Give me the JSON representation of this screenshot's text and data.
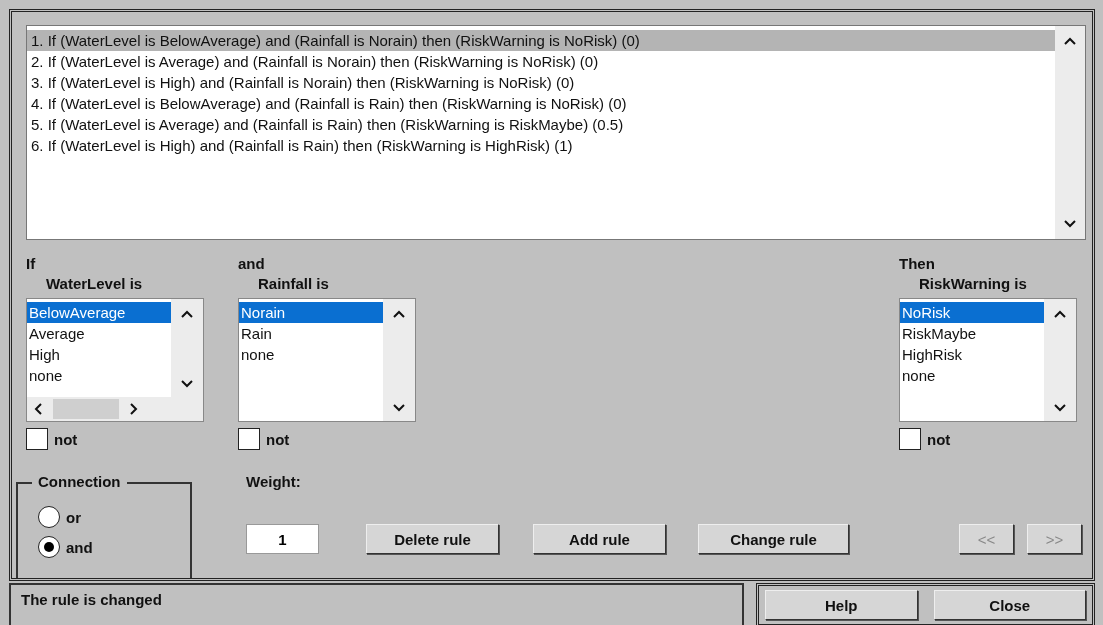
{
  "rules": [
    {
      "text": "1. If (WaterLevel is BelowAverage) and (Rainfall is Norain) then (RiskWarning is NoRisk) (0)",
      "selected": true
    },
    {
      "text": "2. If (WaterLevel is Average) and (Rainfall is Norain) then (RiskWarning is NoRisk) (0)",
      "selected": false
    },
    {
      "text": "3. If (WaterLevel is High) and (Rainfall is Norain) then (RiskWarning is NoRisk) (0)",
      "selected": false
    },
    {
      "text": "4. If (WaterLevel is BelowAverage) and (Rainfall is Rain) then (RiskWarning is NoRisk) (0)",
      "selected": false
    },
    {
      "text": "5. If (WaterLevel is Average) and (Rainfall is Rain) then (RiskWarning is RiskMaybe) (0.5)",
      "selected": false
    },
    {
      "text": "6. If (WaterLevel is High) and (Rainfall is Rain) then (RiskWarning is HighRisk) (1)",
      "selected": false
    }
  ],
  "variables": [
    {
      "prefix": "If",
      "label": "WaterLevel is",
      "horizontal_scrollbar": true,
      "items": [
        {
          "label": "BelowAverage",
          "selected": true
        },
        {
          "label": "Average",
          "selected": false
        },
        {
          "label": "High",
          "selected": false
        },
        {
          "label": "none",
          "selected": false
        }
      ],
      "not_label": "not",
      "not_checked": false
    },
    {
      "prefix": "and",
      "label": "Rainfall is",
      "horizontal_scrollbar": false,
      "items": [
        {
          "label": "Norain",
          "selected": true
        },
        {
          "label": "Rain",
          "selected": false
        },
        {
          "label": "none",
          "selected": false
        }
      ],
      "not_label": "not",
      "not_checked": false
    },
    {
      "prefix": "Then",
      "label": "RiskWarning is",
      "horizontal_scrollbar": false,
      "items": [
        {
          "label": "NoRisk",
          "selected": true
        },
        {
          "label": "RiskMaybe",
          "selected": false
        },
        {
          "label": "HighRisk",
          "selected": false
        },
        {
          "label": "none",
          "selected": false
        }
      ],
      "not_label": "not",
      "not_checked": false
    }
  ],
  "connection": {
    "title": "Connection",
    "options": [
      {
        "label": "or",
        "selected": false
      },
      {
        "label": "and",
        "selected": true
      }
    ]
  },
  "weight": {
    "label": "Weight:",
    "value": "1"
  },
  "rule_buttons": [
    {
      "label": "Delete rule",
      "disabled": false
    },
    {
      "label": "Add rule",
      "disabled": false
    },
    {
      "label": "Change rule",
      "disabled": false
    }
  ],
  "nav_buttons": [
    {
      "label": "<<",
      "disabled": true
    },
    {
      "label": ">>",
      "disabled": true
    }
  ],
  "status": "The rule is changed",
  "footer_buttons": [
    {
      "label": "Help"
    },
    {
      "label": "Close"
    }
  ]
}
